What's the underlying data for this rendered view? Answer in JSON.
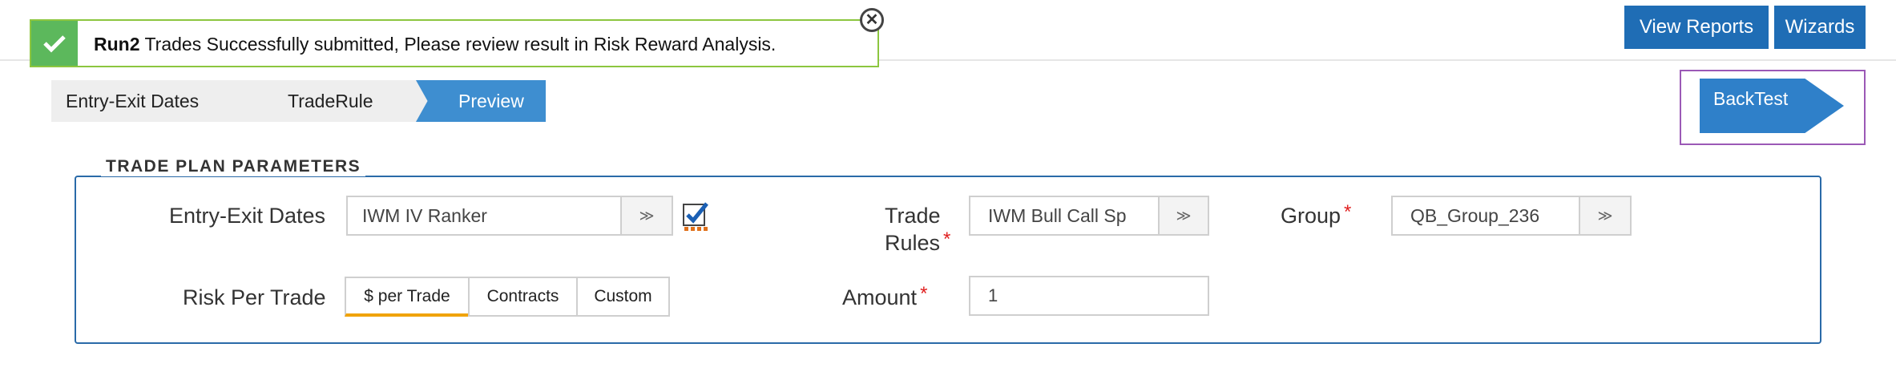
{
  "toast": {
    "run_name": "Run2",
    "message": "Trades Successfully submitted, Please review result in Risk Reward Analysis.",
    "close_glyph": "✕",
    "status_color": "#5cb85c"
  },
  "header": {
    "view_reports": "View Reports",
    "wizards": "Wizards"
  },
  "steps": [
    {
      "label": "Entry-Exit Dates"
    },
    {
      "label": "TradeRule"
    },
    {
      "label": "Preview"
    }
  ],
  "backtest": {
    "label": "BackTest"
  },
  "trade_plan": {
    "legend": "TRADE PLAN PARAMETERS",
    "entry_exit": {
      "label": "Entry-Exit Dates",
      "value": "IWM IV Ranker"
    },
    "trade_rules": {
      "label_line1": "Trade",
      "label_line2": "Rules",
      "value": "IWM Bull Call Sp"
    },
    "group": {
      "label": "Group",
      "value": "QB_Group_236"
    },
    "risk_per_trade": {
      "label": "Risk Per Trade",
      "options": [
        "$ per Trade",
        "Contracts",
        "Custom"
      ],
      "selected": "$ per Trade"
    },
    "amount": {
      "label": "Amount",
      "value": "1"
    },
    "required_mark": "*",
    "dropdown_glyph": "≫"
  }
}
